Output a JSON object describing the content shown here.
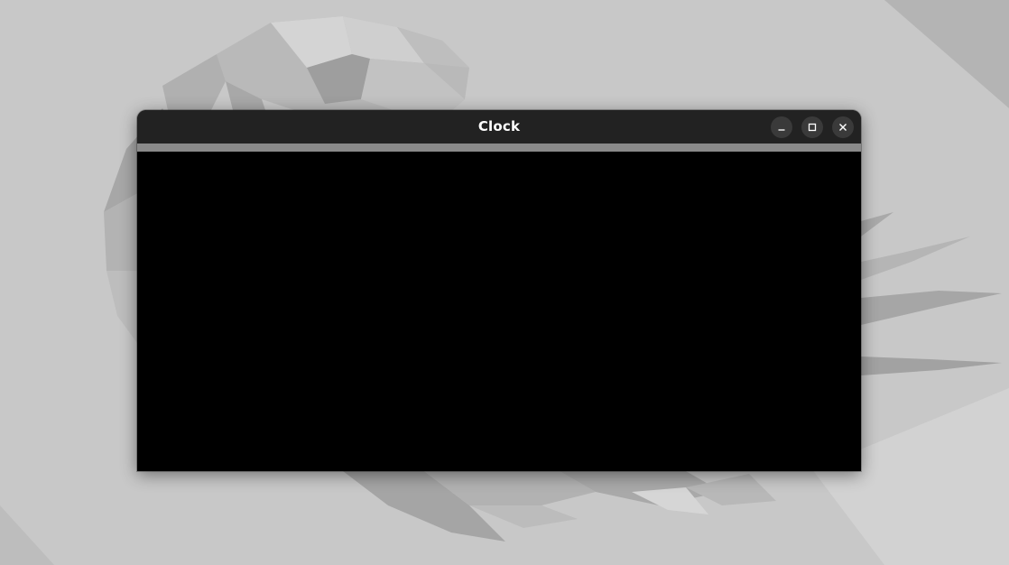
{
  "window": {
    "title": "Clock"
  },
  "controls": {
    "minimize_icon": "minimize-icon",
    "maximize_icon": "maximize-icon",
    "close_icon": "close-icon"
  },
  "colors": {
    "titlebar": "#222222",
    "strip": "#8a8a8a",
    "content": "#000000",
    "desktop": "#c9c9c9"
  }
}
